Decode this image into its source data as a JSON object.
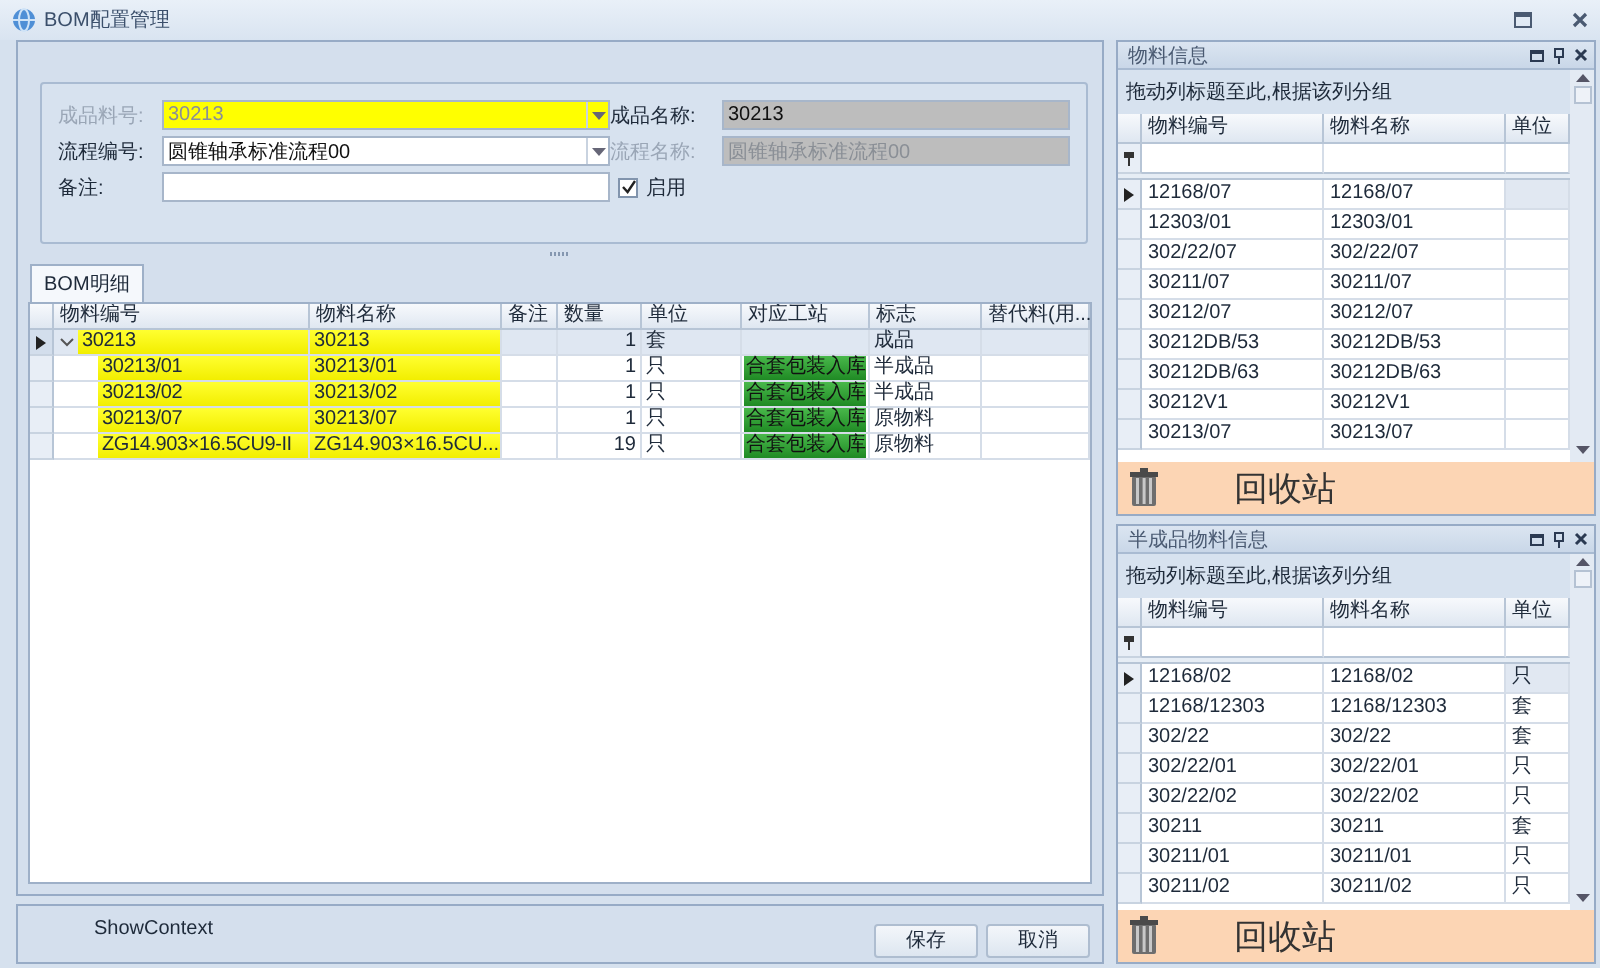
{
  "window": {
    "title": "BOM配置管理"
  },
  "form": {
    "fields": [
      {
        "label": "成品料号:",
        "value": "30213",
        "kind": "combo",
        "disabled": true,
        "highlighted": true
      },
      {
        "label": "成品名称:",
        "value": "30213",
        "kind": "readonly",
        "disabled": false,
        "highlighted": false
      },
      {
        "label": "流程编号:",
        "value": "圆锥轴承标准流程00",
        "kind": "combo",
        "disabled": false,
        "highlighted": false
      },
      {
        "label": "流程名称:",
        "value": "圆锥轴承标准流程00",
        "kind": "readonly",
        "disabled": true,
        "highlighted": false
      },
      {
        "label": "备注:",
        "kind": "text",
        "disabled": false,
        "highlighted": false
      }
    ],
    "checkbox": {
      "label": "启用",
      "checked": true
    }
  },
  "tabs": [
    {
      "label": "BOM明细",
      "selected": true
    }
  ],
  "bom_table": {
    "columns": [
      "物料编号",
      "物料名称",
      "备注",
      "数量",
      "单位",
      "对应工站",
      "标志",
      "替代料(用..."
    ],
    "rows": [
      {
        "code": "30213",
        "name": "30213",
        "qty": "1",
        "unit": "套",
        "flag": "成品",
        "selected": true,
        "expanded": true,
        "children": [
          {
            "code": "30213/01",
            "name": "30213/01",
            "qty": "1",
            "unit": "只",
            "station": "合套包装入库",
            "flag": "半成品",
            "selected": false
          },
          {
            "code": "30213/02",
            "name": "30213/02",
            "qty": "1",
            "unit": "只",
            "station": "合套包装入库",
            "flag": "半成品",
            "selected": false
          },
          {
            "code": "30213/07",
            "name": "30213/07",
            "qty": "1",
            "unit": "只",
            "station": "合套包装入库",
            "flag": "原物料",
            "selected": false
          },
          {
            "code": "ZG14.903×16.5CU9-II",
            "name": "ZG14.903×16.5CU...",
            "qty": "19",
            "unit": "只",
            "station": "合套包装入库",
            "flag": "原物料",
            "selected": false
          }
        ]
      }
    ]
  },
  "footer": {
    "context": "ShowContext",
    "buttons": [
      "保存",
      "取消"
    ]
  },
  "panels": [
    {
      "title": "物料信息",
      "group_hint": "拖动列标题至此,根据该列分组",
      "columns": [
        "物料编号",
        "物料名称",
        "单位"
      ],
      "recycle": "回收站",
      "rows": [
        {
          "code": "12168/07",
          "name": "12168/07",
          "selected": true
        },
        {
          "code": "12303/01",
          "name": "12303/01",
          "selected": false
        },
        {
          "code": "302/22/07",
          "name": "302/22/07",
          "selected": false
        },
        {
          "code": "30211/07",
          "name": "30211/07",
          "selected": false
        },
        {
          "code": "30212/07",
          "name": "30212/07",
          "selected": false
        },
        {
          "code": "30212DB/53",
          "name": "30212DB/53",
          "selected": false
        },
        {
          "code": "30212DB/63",
          "name": "30212DB/63",
          "selected": false
        },
        {
          "code": "30212V1",
          "name": "30212V1",
          "selected": false
        },
        {
          "code": "30213/07",
          "name": "30213/07",
          "selected": false
        }
      ]
    },
    {
      "title": "半成品物料信息",
      "group_hint": "拖动列标题至此,根据该列分组",
      "columns": [
        "物料编号",
        "物料名称",
        "单位"
      ],
      "recycle": "回收站",
      "rows": [
        {
          "code": "12168/02",
          "name": "12168/02",
          "unit": "只",
          "selected": true
        },
        {
          "code": "12168/12303",
          "name": "12168/12303",
          "unit": "套",
          "selected": false
        },
        {
          "code": "302/22",
          "name": "302/22",
          "unit": "套",
          "selected": false
        },
        {
          "code": "302/22/01",
          "name": "302/22/01",
          "unit": "只",
          "selected": false
        },
        {
          "code": "302/22/02",
          "name": "302/22/02",
          "unit": "只",
          "selected": false
        },
        {
          "code": "30211",
          "name": "30211",
          "unit": "套",
          "selected": false
        },
        {
          "code": "30211/01",
          "name": "30211/01",
          "unit": "只",
          "selected": false
        },
        {
          "code": "30211/02",
          "name": "30211/02",
          "unit": "只",
          "selected": false
        }
      ]
    }
  ]
}
